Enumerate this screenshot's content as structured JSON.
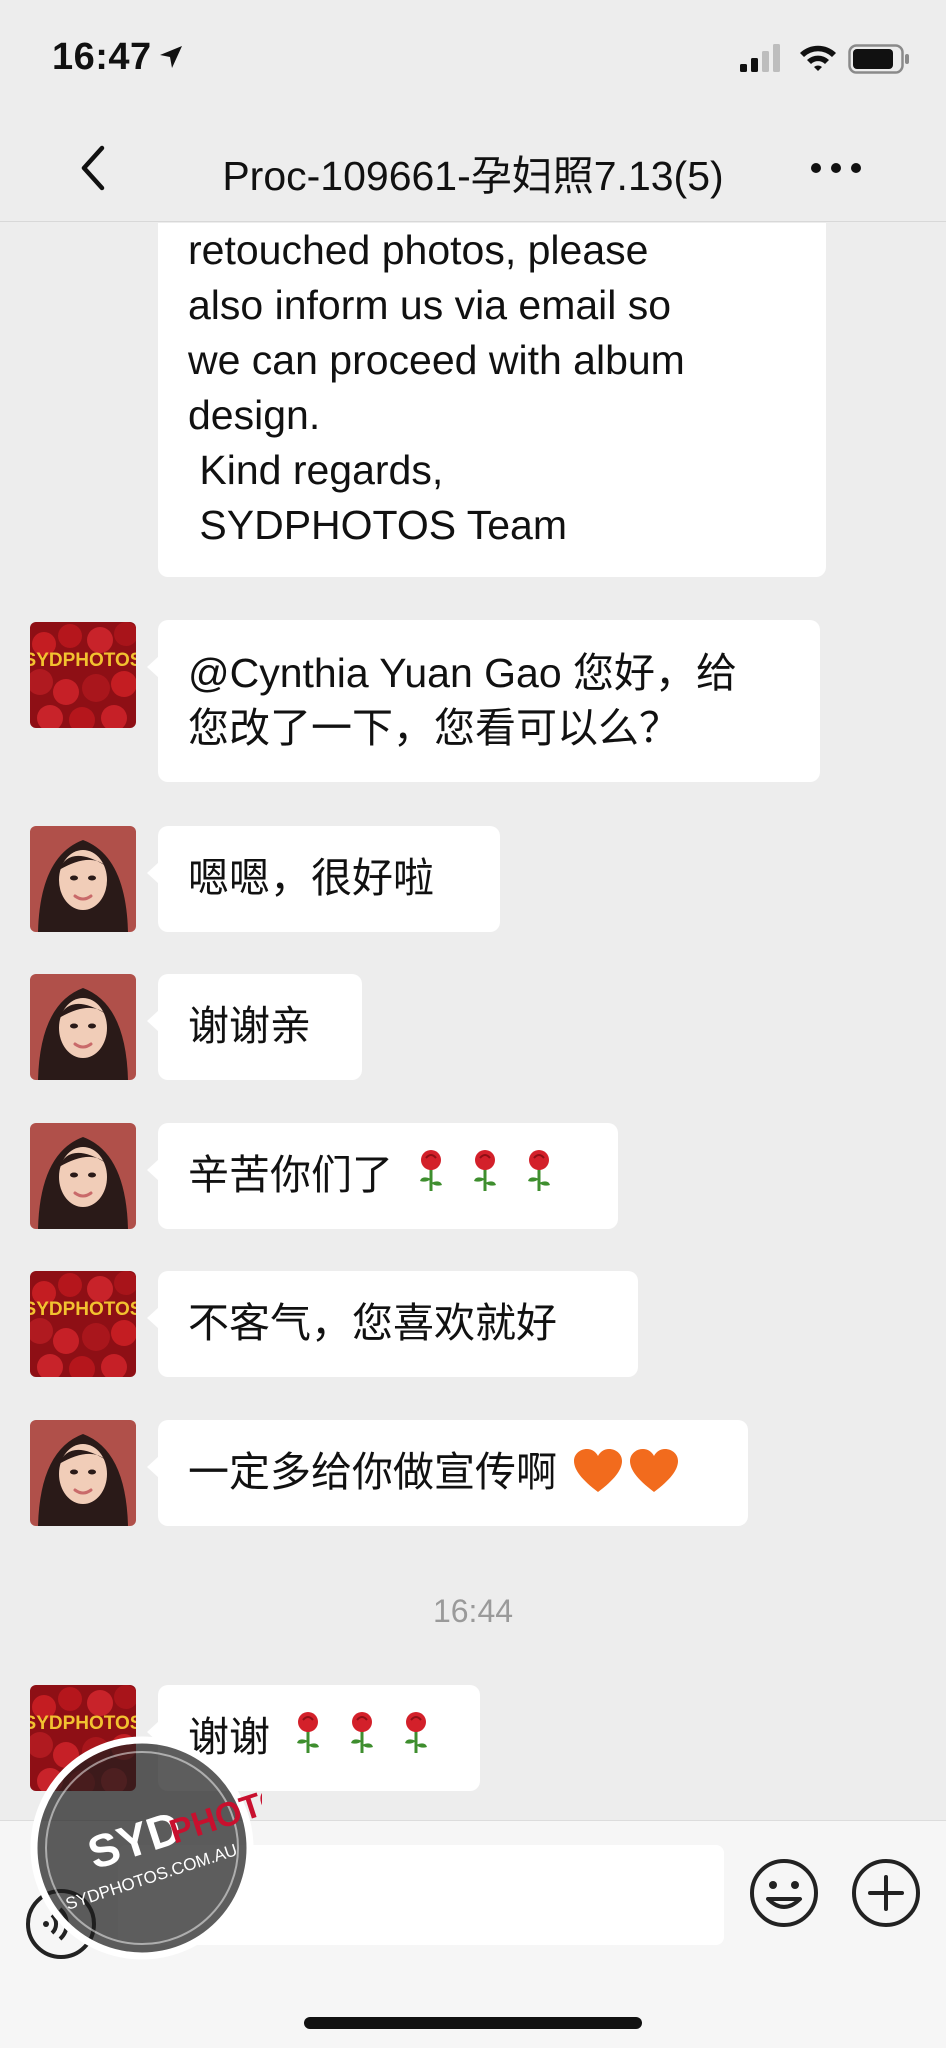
{
  "status_bar": {
    "time": "16:47",
    "location_icon": "location-arrow-icon",
    "signal_icon": "cellular-signal-icon",
    "wifi_icon": "wifi-icon",
    "battery_icon": "battery-icon"
  },
  "nav": {
    "title": "Proc-109661-孕妇照7.13(5)",
    "back_icon": "chevron-left-icon",
    "more_icon": "more-dots-icon"
  },
  "messages": [
    {
      "sender": "SYDPHOTOS",
      "lines": [
        "retouched photos, please",
        "also inform us via email so",
        "we can proceed with album",
        "design.",
        " Kind regards,",
        " SYDPHOTOS Team"
      ]
    },
    {
      "sender": "SYDPHOTOS",
      "avatar_text": "SYDPHOTOS",
      "lines": [
        "@Cynthia Yuan Gao 您好，给",
        "您改了一下，您看可以么？"
      ]
    },
    {
      "sender": "Cynthia",
      "text": "嗯嗯，很好啦"
    },
    {
      "sender": "Cynthia",
      "text": "谢谢亲"
    },
    {
      "sender": "Cynthia",
      "text": "辛苦你们了",
      "emoji": "rose",
      "emoji_count": 3
    },
    {
      "sender": "SYDPHOTOS",
      "avatar_text": "SYDPHOTOS",
      "text": "不客气，您喜欢就好"
    },
    {
      "sender": "Cynthia",
      "text": "一定多给你做宣传啊",
      "emoji": "orange-heart",
      "emoji_count": 2
    },
    {
      "sender": "SYDPHOTOS",
      "avatar_text": "SYDPHOTOS",
      "text": "谢谢",
      "emoji": "rose",
      "emoji_count": 3
    }
  ],
  "time_divider": "16:44",
  "input_bar": {
    "voice_icon": "voice-icon",
    "input_value": "",
    "emoji_icon": "smiley-icon",
    "plus_icon": "plus-circle-icon"
  },
  "watermark": {
    "brand_syd": "SYD",
    "brand_photos": "PHOTOS",
    "domain": "SYDPHOTOS.COM.AU"
  },
  "colors": {
    "background": "#ededed",
    "bubble": "#ffffff",
    "brand_red": "#c8102e",
    "heart": "#f26b1d"
  }
}
